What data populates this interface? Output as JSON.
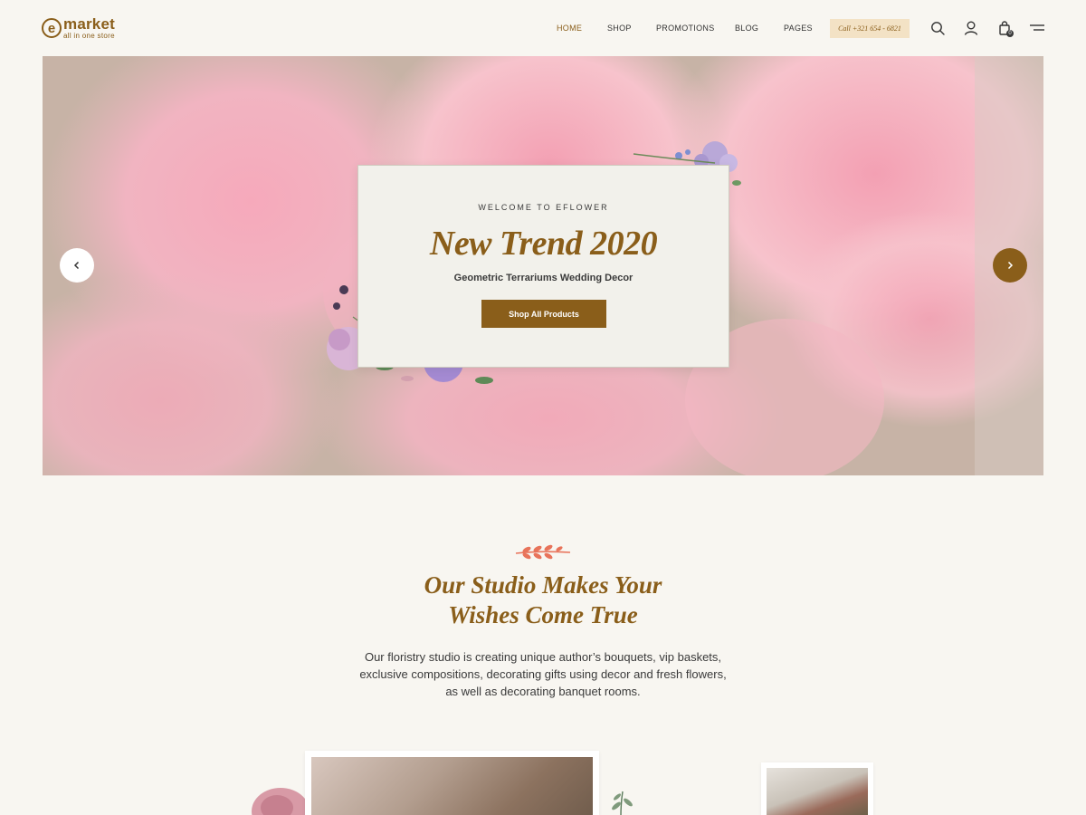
{
  "brand": {
    "logo_letter": "e",
    "name": "market",
    "tagline": "all in one store"
  },
  "nav": {
    "items": [
      {
        "label": "HOME",
        "active": true
      },
      {
        "label": "SHOP",
        "active": false
      },
      {
        "label": "PROMOTIONS",
        "active": false
      },
      {
        "label": "BLOG",
        "active": false
      },
      {
        "label": "PAGES",
        "active": false
      }
    ],
    "call_label": "Call +321 654 - 6821",
    "icons": [
      "search-icon",
      "user-icon",
      "cart-icon",
      "menu-icon"
    ],
    "cart_count": "0"
  },
  "hero": {
    "kicker": "WELCOME TO EFLOWER",
    "title": "New Trend 2020",
    "subtitle": "Geometric Terrariums Wedding Decor",
    "cta_label": "Shop All Products"
  },
  "studio": {
    "title_line1": "Our Studio Makes Your",
    "title_line2": "Wishes Come True",
    "body": "Our floristry studio is creating unique author’s bouquets, vip baskets, exclusive compositions, decorating gifts using decor and fresh flowers, as well as decorating banquet rooms."
  },
  "colors": {
    "accent": "#8a5e1a",
    "background": "#f8f6f1",
    "call_bg": "#f3e2c5",
    "leaf": "#e8735a"
  }
}
